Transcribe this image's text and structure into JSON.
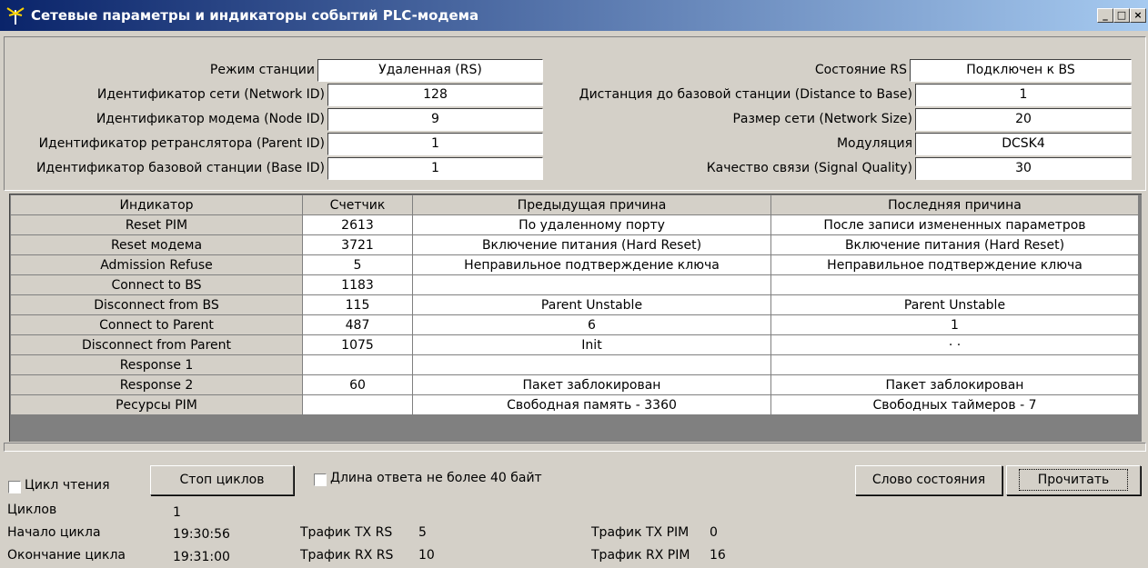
{
  "window": {
    "title": "Сетевые параметры и индикаторы событий PLC-модема",
    "controls": {
      "minimize": "_",
      "maximize": "□",
      "close": "×"
    }
  },
  "params": {
    "left": [
      {
        "label": "Режим станции",
        "value": "Удаленная (RS)"
      },
      {
        "label": "Идентификатор сети (Network ID)",
        "value": "128"
      },
      {
        "label": "Идентификатор модема (Node ID)",
        "value": "9"
      },
      {
        "label": "Идентификатор ретранслятора (Parent ID)",
        "value": "1"
      },
      {
        "label": "Идентификатор базовой станции (Base ID)",
        "value": "1"
      }
    ],
    "right": [
      {
        "label": "Состояние RS",
        "value": "Подключен к BS"
      },
      {
        "label": "Дистанция до базовой станции (Distance to Base)",
        "value": "1"
      },
      {
        "label": "Размер сети (Network Size)",
        "value": "20"
      },
      {
        "label": "Модуляция",
        "value": "DCSK4"
      },
      {
        "label": "Качество связи (Signal Quality)",
        "value": "30"
      }
    ]
  },
  "grid": {
    "headers": [
      "Индикатор",
      "Счетчик",
      "Предыдущая причина",
      "Последняя причина"
    ],
    "rows": [
      [
        "Reset PIM",
        "2613",
        "По удаленному порту",
        "После записи измененных параметров"
      ],
      [
        "Reset модема",
        "3721",
        "Включение питания (Hard Reset)",
        "Включение питания (Hard Reset)"
      ],
      [
        "Admission Refuse",
        "5",
        "Неправильное подтверждение ключа",
        "Неправильное подтверждение ключа"
      ],
      [
        "Connect to BS",
        "1183",
        "",
        ""
      ],
      [
        "Disconnect from BS",
        "115",
        "Parent Unstable",
        "Parent Unstable"
      ],
      [
        "Connect to Parent",
        "487",
        "6",
        "1"
      ],
      [
        "Disconnect from Parent",
        "1075",
        "Init",
        "· ·"
      ],
      [
        "Response 1",
        "",
        "",
        ""
      ],
      [
        "Response 2",
        "60",
        "Пакет заблокирован",
        "Пакет заблокирован"
      ],
      [
        "Ресурсы PIM",
        "",
        "Свободная память - 3360",
        "Свободных таймеров - 7"
      ]
    ]
  },
  "controls": {
    "cycle_read_label": "Цикл чтения",
    "stop_cycles_label": "Стоп циклов",
    "answer_len_label": "Длина ответа не более 40 байт",
    "status_word_label": "Слово состояния",
    "read_label": "Прочитать"
  },
  "stats": {
    "cycles_label": "Циклов",
    "cycles_value": "1",
    "start_label": "Начало цикла",
    "start_value": "19:30:56",
    "end_label": "Окончание цикла",
    "end_value": "19:31:00",
    "tx_rs_label": "Трафик TX RS",
    "tx_rs_value": "5",
    "rx_rs_label": "Трафик RX RS",
    "rx_rs_value": "10",
    "tx_pim_label": "Трафик TX PIM",
    "tx_pim_value": "0",
    "rx_pim_label": "Трафик RX PIM",
    "rx_pim_value": "16"
  }
}
